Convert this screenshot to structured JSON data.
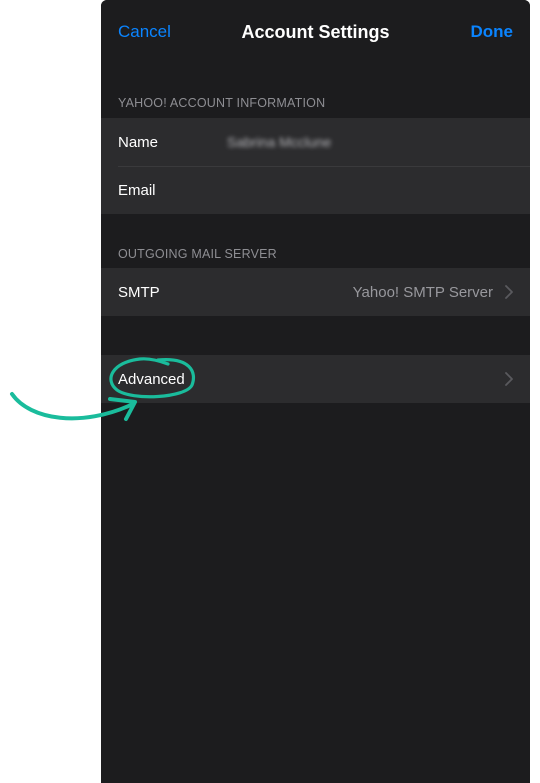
{
  "nav": {
    "cancel_label": "Cancel",
    "title": "Account Settings",
    "done_label": "Done"
  },
  "account_section": {
    "header": "YAHOO! ACCOUNT INFORMATION",
    "rows": [
      {
        "label": "Name",
        "value": "Sabrina Mcclune"
      },
      {
        "label": "Email",
        "value": ""
      }
    ]
  },
  "outgoing_section": {
    "header": "OUTGOING MAIL SERVER",
    "smtp_label": "SMTP",
    "smtp_value": "Yahoo! SMTP Server"
  },
  "advanced_section": {
    "advanced_label": "Advanced"
  },
  "colors": {
    "background": "#1c1c1e",
    "cell": "#2c2c2e",
    "accent": "#0a84ff",
    "annotation": "#1abc9c"
  },
  "icons": {
    "chevron": "chevron-right-icon",
    "annotation_arrow": "curved-arrow-icon"
  }
}
